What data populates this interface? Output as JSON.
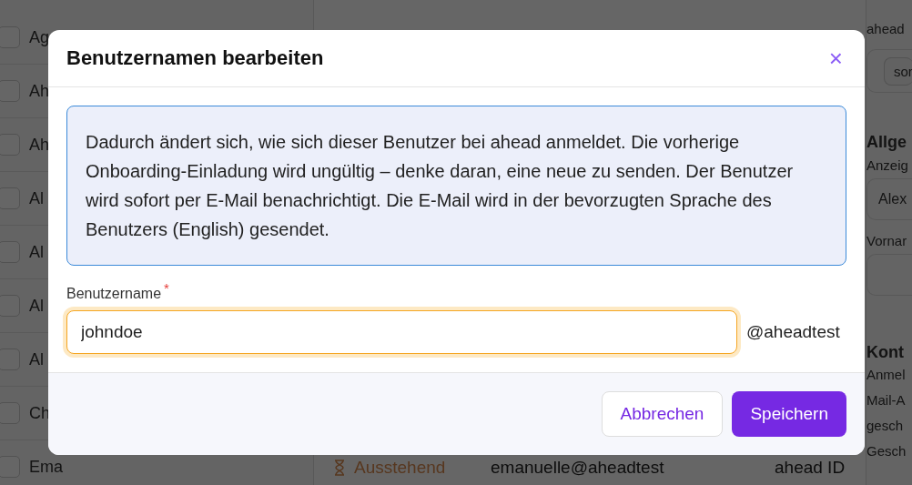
{
  "list": [
    {
      "label": "Ag",
      "checked": false
    },
    {
      "label": "Ah",
      "checked": false
    },
    {
      "label": "Ah",
      "checked": false
    },
    {
      "label": "Al",
      "checked": false
    },
    {
      "label": "Al",
      "checked": false
    },
    {
      "label": "Al",
      "checked": false
    },
    {
      "label": "Al",
      "checked": false
    },
    {
      "label": "Ch",
      "checked": false
    },
    {
      "label": "Ema",
      "checked": false
    }
  ],
  "table_row": {
    "status": "Ausstehend",
    "email": "emanuelle@aheadtest",
    "column_3": "ahead ID"
  },
  "side_panel": [
    {
      "kind": "text",
      "text": "ahead"
    },
    {
      "kind": "chip",
      "text": "sor"
    },
    {
      "kind": "heading",
      "text": "Allge"
    },
    {
      "kind": "label",
      "text": "Anzeig"
    },
    {
      "kind": "field",
      "value": "Alex"
    },
    {
      "kind": "label",
      "text": "Vornar"
    },
    {
      "kind": "field"
    },
    {
      "kind": "heading",
      "text": "Kont"
    },
    {
      "kind": "text",
      "text": "Anmel"
    },
    {
      "kind": "text",
      "text": "Mail-A"
    },
    {
      "kind": "text",
      "text": "gesch"
    },
    {
      "kind": "text",
      "text": "Gesch"
    }
  ],
  "dialog": {
    "title": "Benutzernamen bearbeiten",
    "close": "×",
    "info": "Dadurch ändert sich, wie sich dieser Benutzer bei ahead anmeldet. Die vorherige Onboarding-Einladung wird ungültig – denke daran, eine neue zu senden. Der Benutzer wird sofort per E-Mail benachrichtigt. Die E-Mail wird in der bevorzugten Sprache des Benutzers (English) gesendet.",
    "field": {
      "label": "Benutzername",
      "required_mark": "*",
      "value": "johndoe",
      "suffix": "@aheadtest",
      "focused": true
    },
    "buttons": [
      {
        "label": "Abbrechen",
        "kind": "secondary"
      },
      {
        "label": "Speichern",
        "kind": "primary"
      }
    ]
  }
}
